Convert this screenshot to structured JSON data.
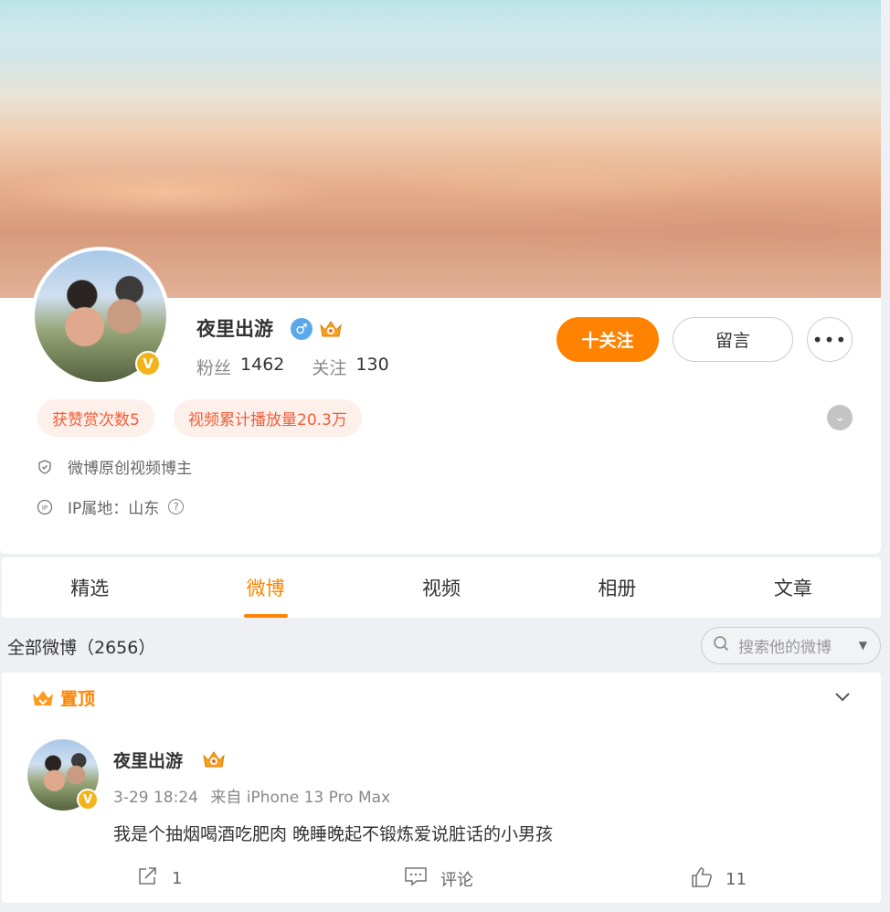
{
  "profile": {
    "username": "夜里出游",
    "verified_badge": "V",
    "gender_icon": "male-icon",
    "fans_label": "粉丝",
    "fans_count": "1462",
    "following_label": "关注",
    "following_count": "130",
    "follow_button": "十关注",
    "message_button": "留言",
    "more_button": "•••",
    "tags": [
      "获赞赏次数5",
      "视频累计播放量20.3万"
    ],
    "creator_label": "微博原创视频博主",
    "ip_label": "IP属地：山东",
    "help_icon": "?"
  },
  "tabs": [
    {
      "label": "精选",
      "active": false
    },
    {
      "label": "微博",
      "active": true
    },
    {
      "label": "视频",
      "active": false
    },
    {
      "label": "相册",
      "active": false
    },
    {
      "label": "文章",
      "active": false
    }
  ],
  "feed": {
    "all_label": "全部微博（2656）",
    "search_placeholder": "搜索他的微博"
  },
  "post": {
    "pinned_label": "置顶",
    "username": "夜里出游",
    "time": "3-29 18:24",
    "source": "来自 iPhone 13 Pro Max",
    "text": "我是个抽烟喝酒吃肥肉 晚睡晚起不锻炼爱说脏话的小男孩",
    "share_count": "1",
    "comment_label": "评论",
    "like_count": "11"
  },
  "colors": {
    "accent": "#ff8200",
    "tag_text": "#f35c38",
    "tag_bg": "#fdf0ea",
    "verified": "#f3b41b",
    "gender": "#5aa7ea"
  }
}
